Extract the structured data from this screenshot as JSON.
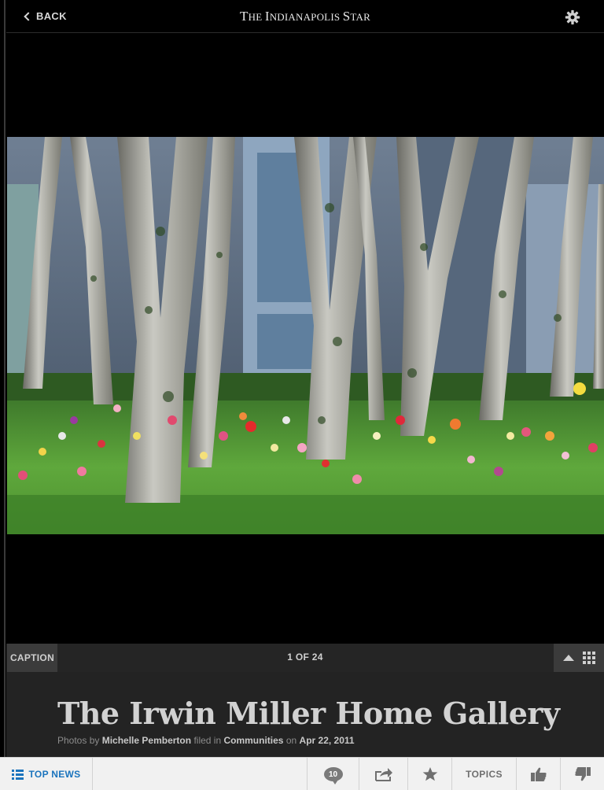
{
  "header": {
    "back_label": "BACK",
    "masthead_the": "T",
    "masthead_he": "HE ",
    "masthead_i": "I",
    "masthead_ndianapolis": "NDIANAPOLIS ",
    "masthead_s": "S",
    "masthead_tar": "TAR"
  },
  "gallery": {
    "caption_label": "CAPTION",
    "counter": "1 OF 24",
    "title": "The Irwin Miller Home Gallery",
    "byline": {
      "photos_by": "Photos by",
      "author": "Michelle Pemberton",
      "filed_in": "filed in",
      "section": "Communities",
      "on": "on",
      "date": "Apr 22, 2011"
    }
  },
  "toolbar": {
    "top_news": "TOP NEWS",
    "comments_count": "10",
    "topics": "TOPICS"
  },
  "colors": {
    "accent": "#1b74bd",
    "background": "#000000",
    "panel": "#232323",
    "toolbar": "#f1f1f1"
  }
}
